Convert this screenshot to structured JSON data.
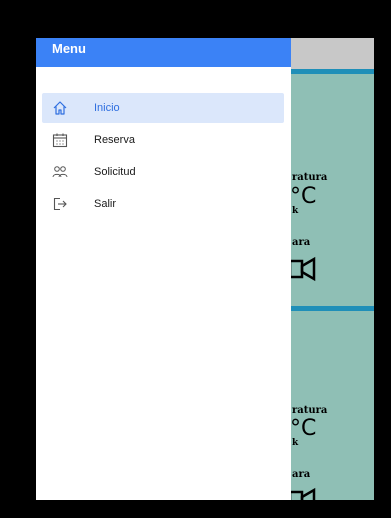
{
  "drawer": {
    "title": "Menu",
    "items": [
      {
        "label": "Inicio",
        "icon": "home-icon",
        "active": true
      },
      {
        "label": "Reserva",
        "icon": "calendar-icon",
        "active": false
      },
      {
        "label": "Solicitud",
        "icon": "users-icon",
        "active": false
      },
      {
        "label": "Salir",
        "icon": "logout-icon",
        "active": false
      }
    ]
  },
  "background_cards": [
    {
      "label_a": "ratura",
      "big": "°C",
      "small": "k",
      "label_b": "ara"
    },
    {
      "label_a": "ratura",
      "big": "°C",
      "small": "k",
      "label_b": "ara"
    }
  ],
  "colors": {
    "drawer_header": "#3b82f6",
    "active_item_bg": "#dbe7fb",
    "active_item_text": "#2f6fe0",
    "card_bg": "#8fbfb5",
    "card_accent": "#1f8fb8"
  }
}
